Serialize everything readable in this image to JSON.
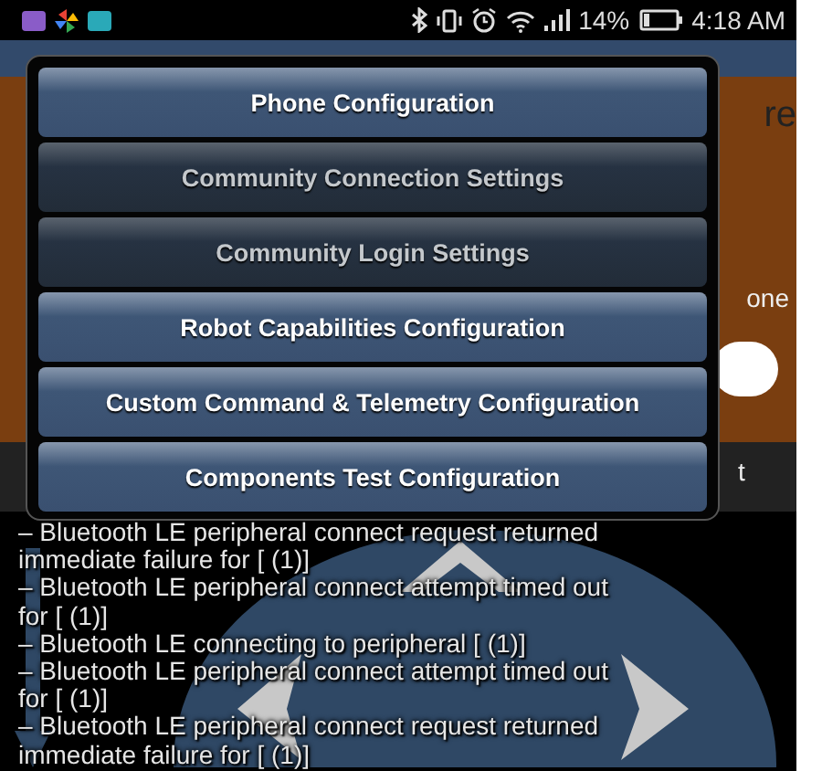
{
  "status_bar": {
    "battery_text": "14%",
    "time": "4:18 AM"
  },
  "background": {
    "header_text": "re",
    "side_text": "one",
    "lower_text": "t"
  },
  "menu": {
    "buttons": [
      {
        "label": "Phone Configuration",
        "disabled": false
      },
      {
        "label": "Community Connection Settings",
        "disabled": true
      },
      {
        "label": "Community Login Settings",
        "disabled": true
      },
      {
        "label": "Robot Capabilities Configuration",
        "disabled": false
      },
      {
        "label": "Custom Command & Telemetry Configuration",
        "disabled": false
      },
      {
        "label": "Components Test Configuration",
        "disabled": false
      }
    ]
  },
  "log_lines": [
    "– Bluetooth LE peripheral connect request returned",
    "immediate failure for [ (1)]",
    "– Bluetooth LE peripheral connect attempt timed out",
    "for [ (1)]",
    "– Bluetooth LE connecting to peripheral [ (1)]",
    "– Bluetooth LE peripheral connect attempt timed out",
    "for [ (1)]",
    "– Bluetooth LE peripheral connect request returned",
    "immediate failure for [ (1)]"
  ]
}
